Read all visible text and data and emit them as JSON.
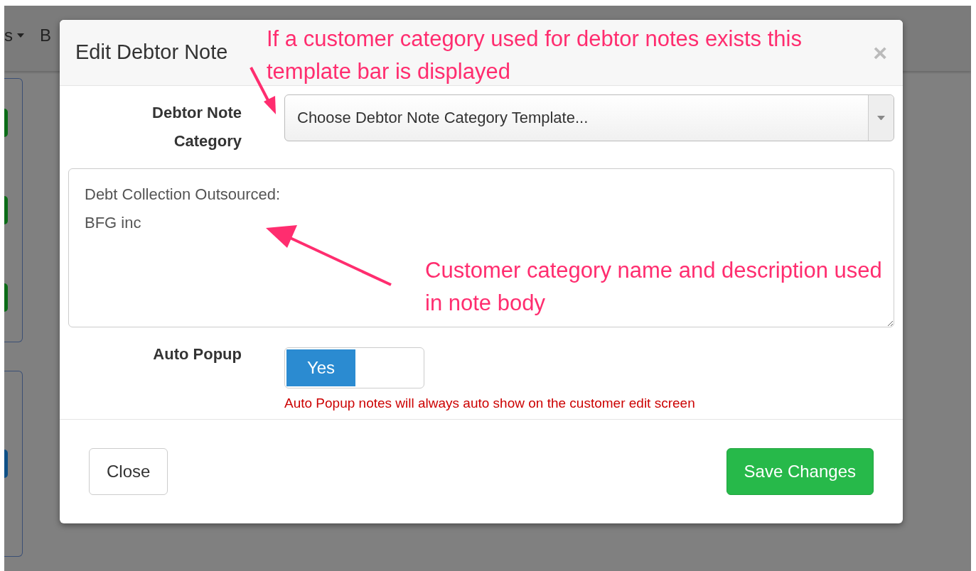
{
  "navbar": {
    "items": [
      {
        "label": "s",
        "caret": true
      },
      {
        "label": "B",
        "caret": false
      }
    ]
  },
  "modal": {
    "title": "Edit Debtor Note",
    "close": "×",
    "category": {
      "label": "Debtor Note Category",
      "placeholder": "Choose Debtor Note Category Template..."
    },
    "note_body": {
      "value": "Debt Collection Outsourced:\nBFG inc"
    },
    "auto_popup": {
      "label": "Auto Popup",
      "on": true,
      "on_label": "Yes",
      "help": "Auto Popup notes will always auto show on the customer edit screen"
    },
    "buttons": [
      {
        "label": "Close",
        "kind": "default"
      },
      {
        "label": "Save Changes",
        "kind": "primary"
      }
    ]
  },
  "annotations": [
    {
      "text": "If a customer category used for debtor notes exists this template bar is displayed"
    },
    {
      "text": "Customer category name and description used in note body"
    }
  ]
}
